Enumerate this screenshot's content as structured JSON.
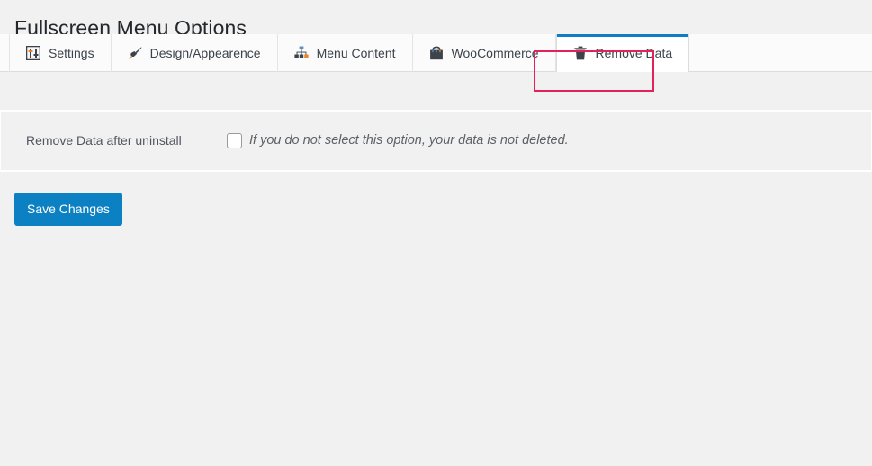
{
  "header": {
    "title": "Fullscreen Menu Options"
  },
  "tabs": [
    {
      "id": "settings",
      "label": "Settings",
      "icon": "sliders-icon",
      "active": false
    },
    {
      "id": "design",
      "label": "Design/Appearence",
      "icon": "paintbrush-icon",
      "active": false
    },
    {
      "id": "menucontent",
      "label": "Menu Content",
      "icon": "sitemap-icon",
      "active": false
    },
    {
      "id": "woocommerce",
      "label": "WooCommerce",
      "icon": "shopping-bag-icon",
      "active": false
    },
    {
      "id": "removedata",
      "label": "Remove Data",
      "icon": "trash-icon",
      "active": true
    }
  ],
  "form": {
    "row": {
      "label": "Remove Data after uninstall",
      "checkbox_checked": false,
      "description": "If you do not select this option, your data is not deleted."
    }
  },
  "submit": {
    "save_label": "Save Changes"
  },
  "colors": {
    "accent_blue": "#0d7ec6",
    "button_blue": "#0b80c2",
    "highlight_crimson": "#e3225c",
    "page_background": "#f1f1f1",
    "title_text": "#23282d"
  }
}
